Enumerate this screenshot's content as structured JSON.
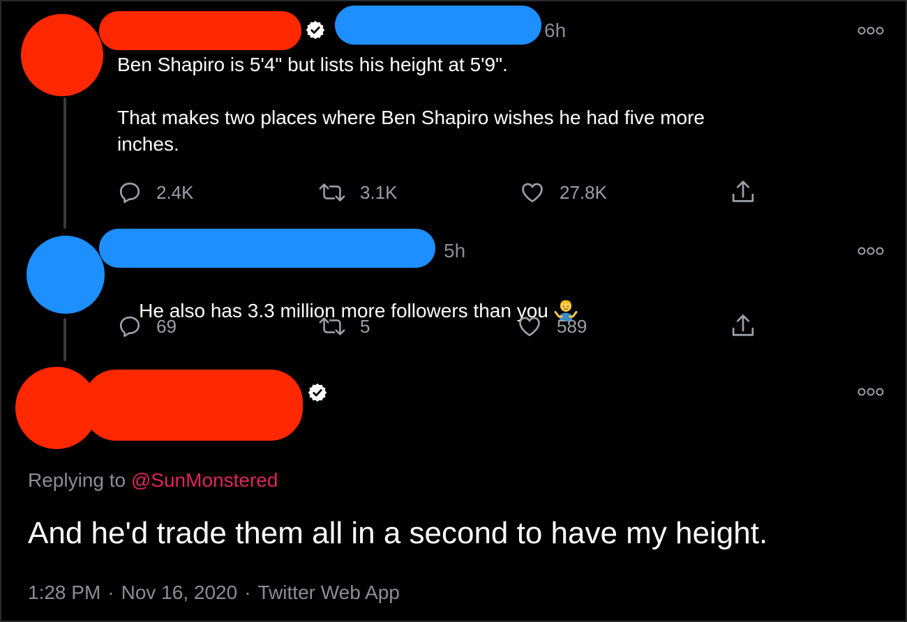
{
  "colors": {
    "redacted_red": "#ff2800",
    "redacted_blue": "#1e8fff",
    "muted_text": "#8b8f94",
    "mention_pink": "#e0245e"
  },
  "tweets": [
    {
      "time": "6h",
      "verified": true,
      "text": "Ben Shapiro is 5'4\" but lists his height at 5'9\".\n\nThat makes two places where Ben Shapiro wishes he had five more\ninches.",
      "actions": {
        "replies": "2.4K",
        "retweets": "3.1K",
        "likes": "27.8K"
      }
    },
    {
      "time": "5h",
      "verified": false,
      "text": "He also has 3.3 million more followers than you",
      "emoji": "person-shrugging-emoji",
      "actions": {
        "replies": "69",
        "retweets": "5",
        "likes": "589"
      }
    }
  ],
  "main_tweet": {
    "verified": true,
    "replying_prefix": "Replying to",
    "replying_handle": "@SunMonstered",
    "text": "And he'd trade them all in a second to have my height.",
    "meta": {
      "time": "1:28 PM",
      "sep1": "·",
      "date": "Nov 16, 2020",
      "sep2": "·",
      "source": "Twitter Web App"
    }
  },
  "icons": {
    "reply": "reply-bubble-icon",
    "retweet": "retweet-icon",
    "like": "heart-icon",
    "share": "share-upload-icon",
    "more": "more-dots-icon",
    "verified": "verified-badge-icon"
  }
}
